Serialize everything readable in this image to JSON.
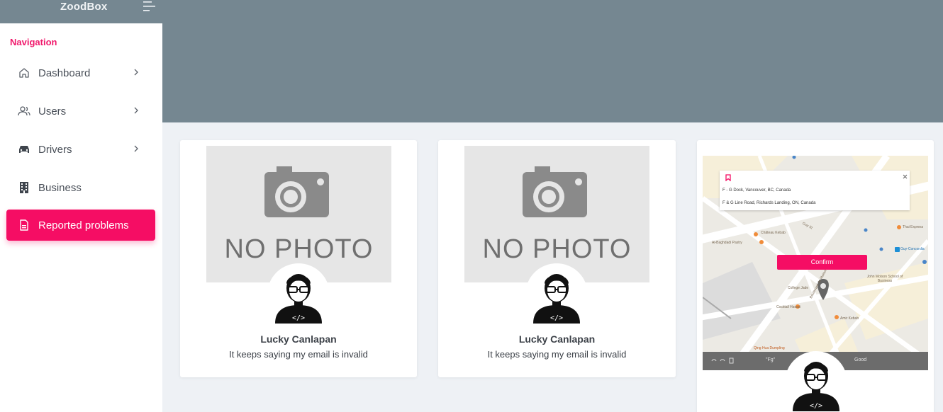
{
  "brand": {
    "title": "ZoodBox"
  },
  "sidebar": {
    "heading": "Navigation",
    "items": [
      {
        "label": "Dashboard",
        "icon": "home-icon",
        "has_chevron": true,
        "active": false
      },
      {
        "label": "Users",
        "icon": "users-icon",
        "has_chevron": true,
        "active": false
      },
      {
        "label": "Drivers",
        "icon": "car-icon",
        "has_chevron": true,
        "active": false
      },
      {
        "label": "Business",
        "icon": "building-icon",
        "has_chevron": false,
        "active": false
      },
      {
        "label": "Reported problems",
        "icon": "file-icon",
        "has_chevron": false,
        "active": true
      }
    ]
  },
  "cards": [
    {
      "photo_text": "NO PHOTO",
      "name": "Lucky Canlapan",
      "description": "It keeps saying my email is invalid"
    },
    {
      "photo_text": "NO PHOTO",
      "name": "Lucky Canlapan",
      "description": "It keeps saying my email is invalid"
    },
    {
      "map": {
        "address_from": "F - G Dock, Vancouver, BC, Canada",
        "address_to": "F & G Line Road, Richards Landing, ON, Canada",
        "confirm_label": "Confirm",
        "labels": {
          "chateau": "Château Kebab",
          "baghdadi": "Al-Baghdadi Pastry",
          "guy_st": "Guy St",
          "thai": "Thai Express",
          "guy_concordia": "Guy-Concordia",
          "college": "College Jade",
          "molson": "John Molson School of Business",
          "cocktail": "Cocktail Hawaii",
          "amir": "Amir Kebab",
          "qing": "Qing Hua Dumpling",
          "boulevard": "Boulevard de Maisonneuve O"
        },
        "toolbar": {
          "quote": "\"Fg\"",
          "good": "Good"
        }
      }
    }
  ],
  "colors": {
    "accent": "#f50d64",
    "header": "#758791",
    "background": "#eef1f5"
  }
}
